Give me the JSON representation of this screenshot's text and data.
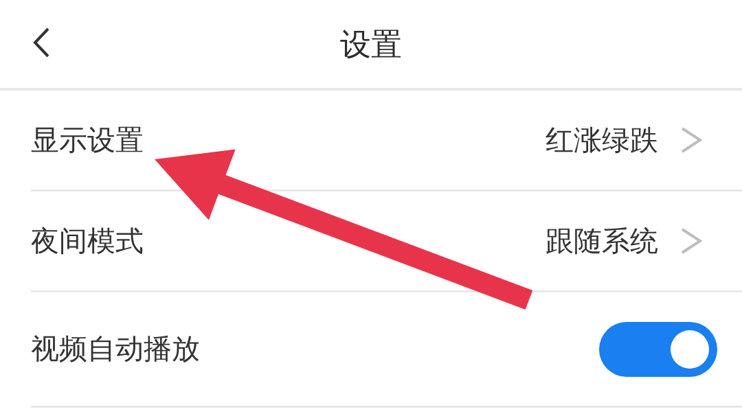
{
  "header": {
    "title": "设置"
  },
  "settings": [
    {
      "kind": "link",
      "label": "显示设置",
      "value": "红涨绿跌"
    },
    {
      "kind": "link",
      "label": "夜间模式",
      "value": "跟随系统"
    },
    {
      "kind": "toggle",
      "label": "视频自动播放",
      "on": true
    }
  ],
  "annotation": {
    "kind": "arrow"
  }
}
